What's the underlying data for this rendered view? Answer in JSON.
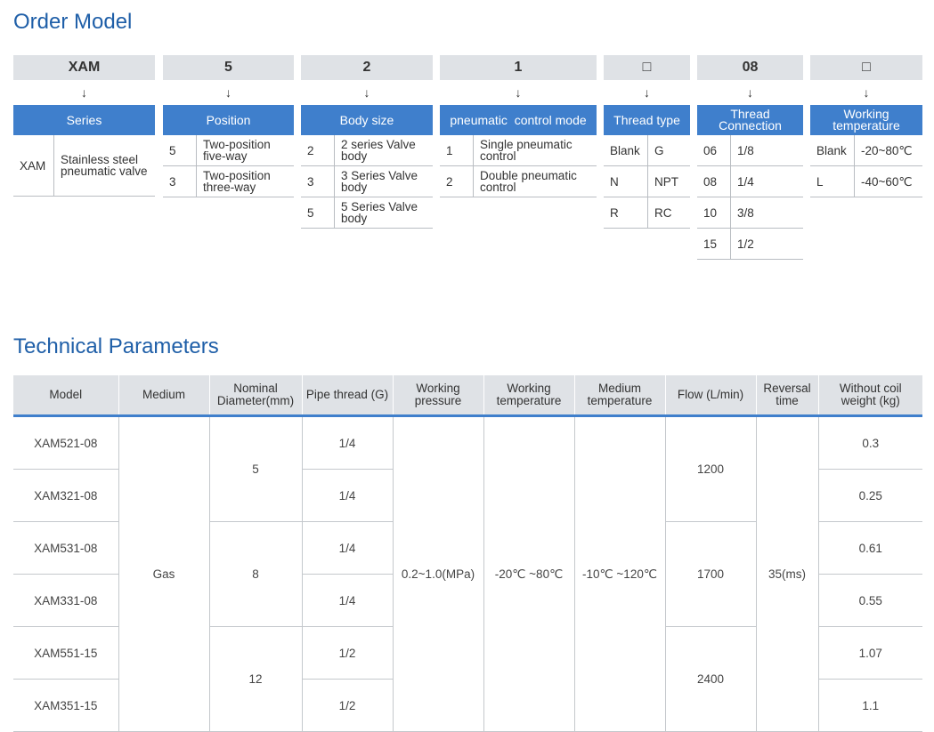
{
  "order_model": {
    "title": "Order Model",
    "arrow": "↓",
    "columns": [
      {
        "code": "XAM",
        "header": "Series",
        "rows": [
          {
            "k": "XAM",
            "v": "Stainless steel pneumatic valve"
          }
        ]
      },
      {
        "code": "5",
        "header": "Position",
        "rows": [
          {
            "k": "5",
            "v": "Two-position five-way"
          },
          {
            "k": "3",
            "v": "Two-position three-way"
          }
        ]
      },
      {
        "code": "2",
        "header": "Body size",
        "rows": [
          {
            "k": "2",
            "v": "2 series Valve body"
          },
          {
            "k": "3",
            "v": "3 Series Valve body"
          },
          {
            "k": "5",
            "v": "5 Series Valve body"
          }
        ]
      },
      {
        "code": "1",
        "header": "pneumatic  control mode",
        "rows": [
          {
            "k": "1",
            "v": "Single pneumatic control"
          },
          {
            "k": "2",
            "v": "Double pneumatic control"
          }
        ]
      },
      {
        "code": "□",
        "header": "Thread type",
        "rows": [
          {
            "k": "Blank",
            "v": "G"
          },
          {
            "k": "N",
            "v": "NPT"
          },
          {
            "k": "R",
            "v": "RC"
          }
        ]
      },
      {
        "code": "08",
        "header": "Thread Connection",
        "rows": [
          {
            "k": "06",
            "v": "1/8"
          },
          {
            "k": "08",
            "v": "1/4"
          },
          {
            "k": "10",
            "v": "3/8"
          },
          {
            "k": "15",
            "v": "1/2"
          }
        ]
      },
      {
        "code": "□",
        "header": "Working temperature",
        "rows": [
          {
            "k": "Blank",
            "v": "-20~80℃"
          },
          {
            "k": "L",
            "v": "-40~60℃"
          }
        ]
      }
    ]
  },
  "technical_parameters": {
    "title": "Technical Parameters",
    "headers": [
      "Model",
      "Medium",
      "Nominal Diameter(mm)",
      "Pipe thread (G)",
      "Working pressure",
      "Working temperature",
      "Medium temperature",
      "Flow (L/min)",
      "Reversal time",
      "Without coil weight (kg)"
    ],
    "models": [
      "XAM521-08",
      "XAM321-08",
      "XAM531-08",
      "XAM331-08",
      "XAM551-15",
      "XAM351-15"
    ],
    "medium": "Gas",
    "nominal_diameter": [
      "5",
      "8",
      "12"
    ],
    "pipe_thread": [
      "1/4",
      "1/4",
      "1/4",
      "1/4",
      "1/2",
      "1/2"
    ],
    "working_pressure": "0.2~1.0(MPa)",
    "working_temperature": "-20℃ ~80℃",
    "medium_temperature": "-10℃ ~120℃",
    "flow": [
      "1200",
      "1700",
      "2400"
    ],
    "reversal_time": "35(ms)",
    "weight": [
      "0.3",
      "0.25",
      "0.61",
      "0.55",
      "1.07",
      "1.1"
    ]
  }
}
